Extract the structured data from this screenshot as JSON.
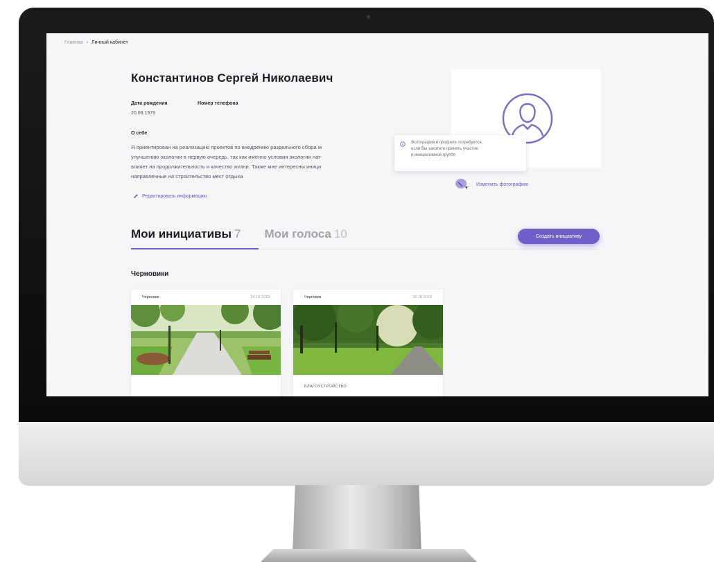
{
  "breadcrumb": {
    "home": "Главная",
    "current": "Личный кабинет"
  },
  "profile": {
    "name": "Константинов Сергей Николаевич",
    "birth_label": "Дата рождения",
    "birth_value": "20.08.1979",
    "phone_label": "Номер телефона",
    "about_label": "О себе",
    "about_lines": [
      "Я ориентирован на реализацию проектов по внедрению раздельного сбора м",
      "улучшению экологии в первую очередь, так как именно условия экологии нат",
      "влияет на продолжительность и качество жизни. Также мне интересны иници",
      "направленные на строительство мест отдыха"
    ],
    "edit_label": "Редактировать информацию"
  },
  "photo": {
    "tooltip_lines": [
      "Фотография в профиле потребуется,",
      "если Вы захотите принять участие",
      "в инициативной группе"
    ],
    "change_label": "Изменить фотографию"
  },
  "tabs": [
    {
      "label": "Мои инициативы",
      "count": "7",
      "active": true
    },
    {
      "label": "Мои голоса",
      "count": "10",
      "active": false
    }
  ],
  "create_button": "Создать инициативу",
  "drafts": {
    "title": "Черновики",
    "cards": [
      {
        "status": "Черновик",
        "date": "24.10.2018",
        "category": ""
      },
      {
        "status": "Черновик",
        "date": "30.10.2018",
        "category": "БЛАГОУСТРОЙСТВО"
      }
    ]
  },
  "colors": {
    "accent": "#6f5fc9",
    "screen_bg": "#f6f6f8",
    "monitor_bezel": "#111112"
  }
}
